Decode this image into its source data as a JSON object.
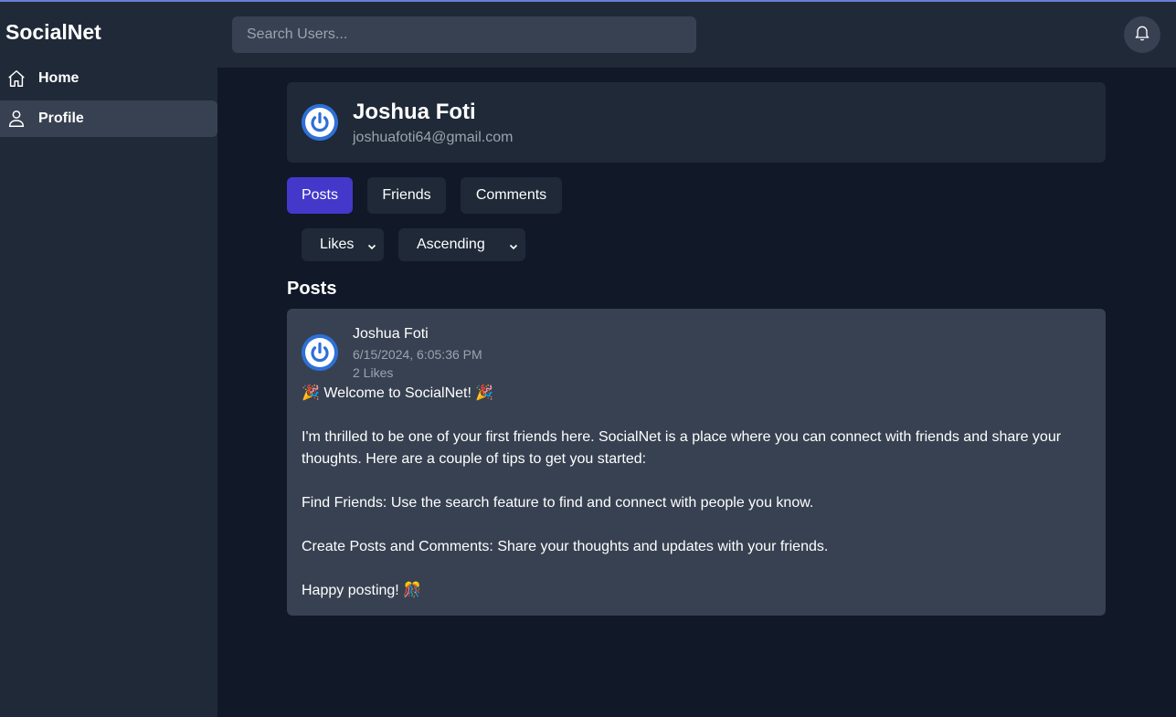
{
  "app": {
    "name": "SocialNet"
  },
  "sidebar": {
    "items": [
      {
        "label": "Home",
        "icon": "home-icon"
      },
      {
        "label": "Profile",
        "icon": "user-icon",
        "active": true
      }
    ]
  },
  "header": {
    "search_placeholder": "Search Users...",
    "bell_icon": "bell-icon"
  },
  "profile": {
    "name": "Joshua Foti",
    "email": "joshuafoti64@gmail.com"
  },
  "tabs": [
    {
      "label": "Posts",
      "active": true
    },
    {
      "label": "Friends"
    },
    {
      "label": "Comments"
    }
  ],
  "sort": {
    "field": "Likes",
    "order": "Ascending"
  },
  "section_title": "Posts",
  "posts": [
    {
      "author": "Joshua Foti",
      "date": "6/15/2024, 6:05:36 PM",
      "likes": "2 Likes",
      "lines": [
        "🎉 Welcome to SocialNet! 🎉",
        "",
        "I'm thrilled to be one of your first friends here. SocialNet is a place where you can connect with friends and share your thoughts. Here are a couple of tips to get you started:",
        "",
        "Find Friends: Use the search feature to find and connect with people you know.",
        "",
        "Create Posts and Comments: Share your thoughts and updates with your friends.",
        "",
        "Happy posting! 🎊"
      ]
    }
  ],
  "colors": {
    "accent": "#4338ca",
    "avatar": "#2563eb",
    "background": "#111827",
    "panel": "#1f2937",
    "card": "#374151"
  }
}
